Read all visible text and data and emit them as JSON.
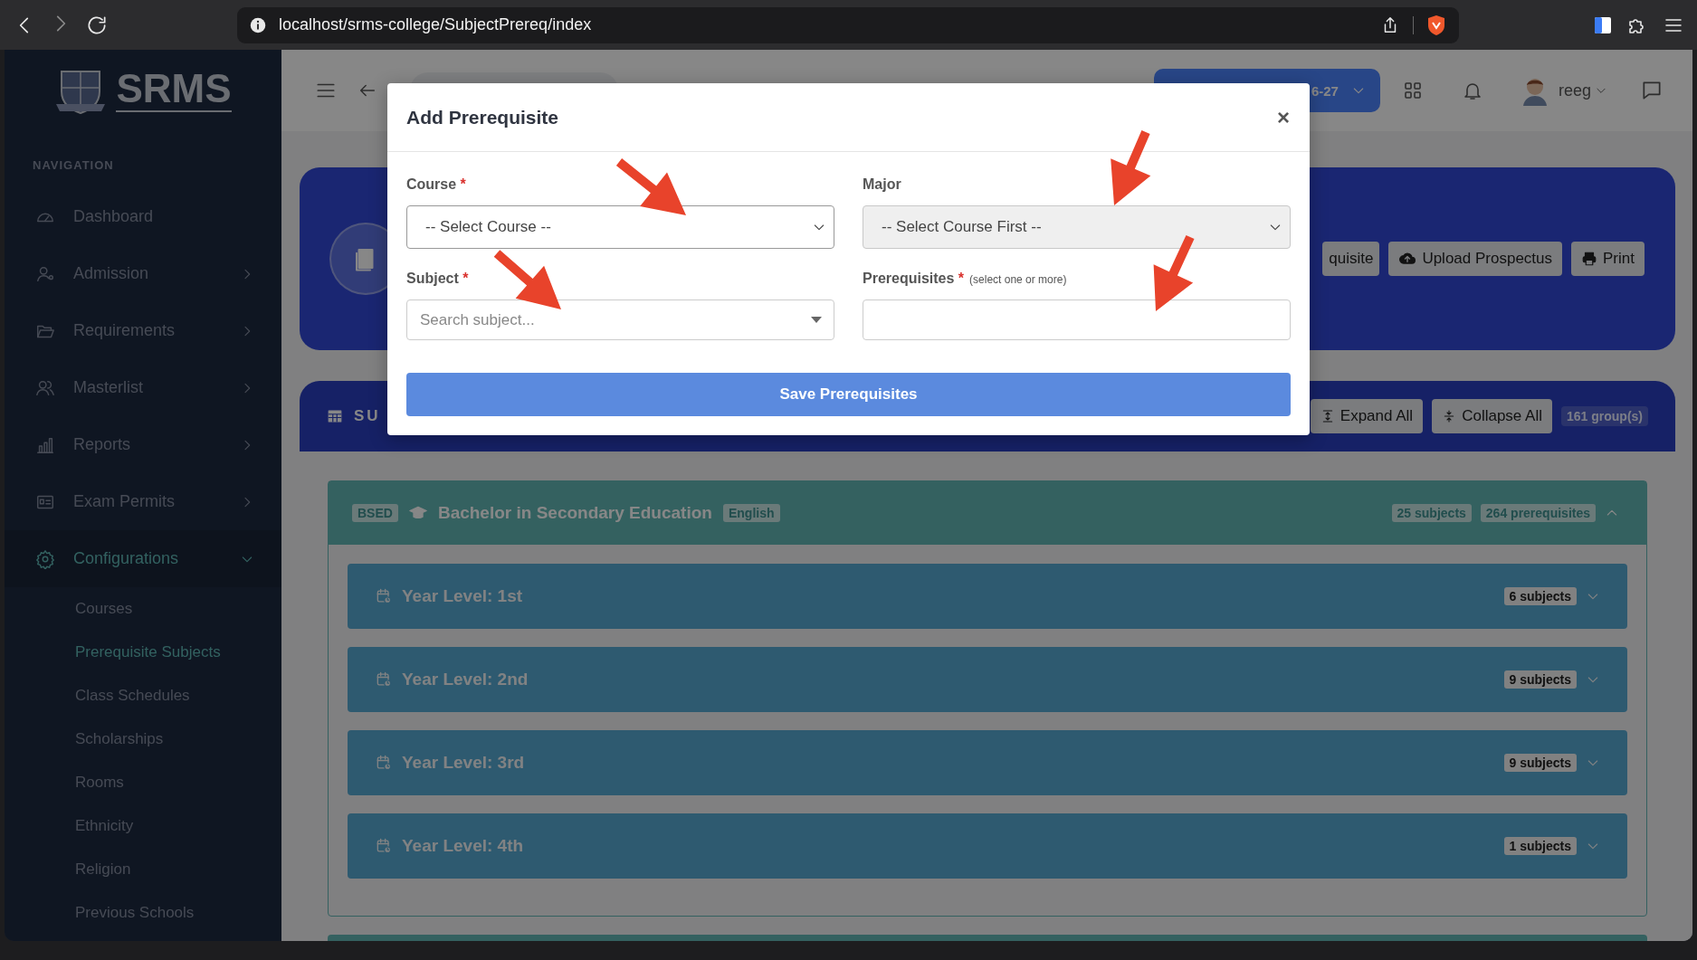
{
  "browser": {
    "url": "localhost/srms-college/SubjectPrereq/index"
  },
  "sidebar": {
    "brand": "SRMS",
    "heading": "NAVIGATION",
    "items": [
      {
        "label": "Dashboard",
        "kind": "link",
        "selected": false
      },
      {
        "label": "Admission",
        "kind": "menu",
        "expanded": false,
        "selected": false
      },
      {
        "label": "Requirements",
        "kind": "menu",
        "expanded": false,
        "selected": false
      },
      {
        "label": "Masterlist",
        "kind": "menu",
        "expanded": false,
        "selected": false
      },
      {
        "label": "Reports",
        "kind": "menu",
        "expanded": false,
        "selected": false
      },
      {
        "label": "Exam Permits",
        "kind": "menu",
        "expanded": false,
        "selected": false
      },
      {
        "label": "Configurations",
        "kind": "menu",
        "expanded": true,
        "selected": true,
        "children": [
          {
            "label": "Courses",
            "selected": false
          },
          {
            "label": "Prerequisite Subjects",
            "selected": true
          },
          {
            "label": "Class Schedules",
            "selected": false
          },
          {
            "label": "Scholarships",
            "selected": false
          },
          {
            "label": "Rooms",
            "selected": false
          },
          {
            "label": "Ethnicity",
            "selected": false
          },
          {
            "label": "Religion",
            "selected": false
          },
          {
            "label": "Previous Schools",
            "selected": false
          }
        ]
      }
    ]
  },
  "topbar": {
    "session": "6-27",
    "user": "reeg"
  },
  "hero": {
    "buttons": [
      {
        "label": "quisite"
      },
      {
        "label": "Upload Prospectus"
      },
      {
        "label": "Print"
      }
    ]
  },
  "section": {
    "title": "SU",
    "buttons": [
      "Expand All",
      "Collapse All"
    ],
    "count": "161 group(s)"
  },
  "groups": [
    {
      "code": "BSED",
      "name": "Bachelor in Secondary Education",
      "major": "English",
      "subjects": "25 subjects",
      "prerequisites": "264 prerequisites",
      "expanded": true,
      "levels": [
        {
          "label": "Year Level: 1st",
          "count": "6 subjects",
          "expanded": false
        },
        {
          "label": "Year Level: 2nd",
          "count": "9 subjects",
          "expanded": false
        },
        {
          "label": "Year Level: 3rd",
          "count": "9 subjects",
          "expanded": false
        },
        {
          "label": "Year Level: 4th",
          "count": "1 subjects",
          "expanded": false
        }
      ]
    }
  ],
  "modal": {
    "title": "Add Prerequisite",
    "close": "×",
    "fields": [
      {
        "label": "Course",
        "mark": "*",
        "kind": "select",
        "value": "-- Select Course --",
        "disabled": false
      },
      {
        "label": "Major",
        "kind": "select",
        "value": "-- Select Course First --",
        "disabled": true
      },
      {
        "label": "Subject",
        "mark": "*",
        "kind": "search",
        "placeholder": "Search subject..."
      },
      {
        "label": "Prerequisites",
        "mark": "*",
        "hint": "(select one or more)",
        "kind": "multi"
      }
    ],
    "submit": "Save Prerequisites"
  }
}
